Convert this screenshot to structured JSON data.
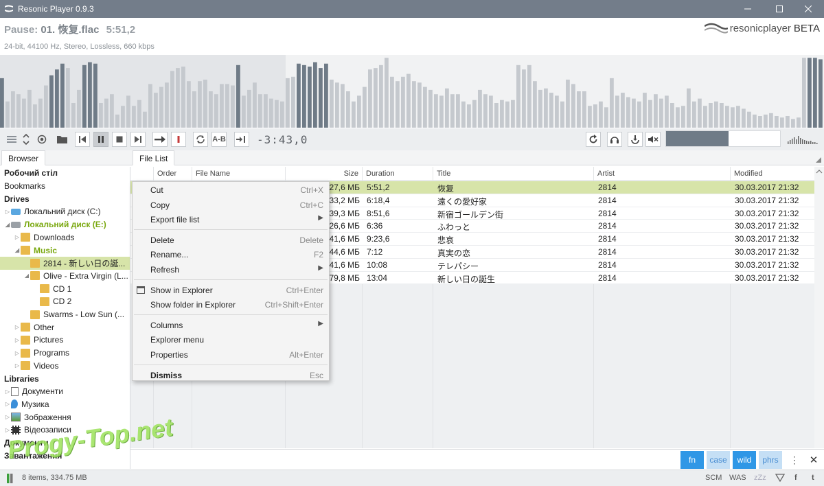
{
  "window": {
    "title": "Resonic Player 0.9.3"
  },
  "now_playing": {
    "state": "Pause:",
    "track": "01.  恢复.flac",
    "time": "5:51,2",
    "info": "24-bit, 44100 Hz, Stereo, Lossless, 660 kbps"
  },
  "brand": {
    "name": "resonicplayer",
    "beta": "BETA"
  },
  "playback": {
    "remaining": "-3:43,0",
    "progress_fraction": 0.347,
    "volume_fraction": 0.55
  },
  "visualizer": {
    "levels": [
      0.68,
      0.36,
      0.5,
      0.46,
      0.4,
      0.52,
      0.32,
      0.4,
      0.58,
      0.72,
      0.8,
      0.88,
      0.82,
      0.34,
      0.52,
      0.86,
      0.9,
      0.88,
      0.34,
      0.4,
      0.46,
      0.18,
      0.3,
      0.44,
      0.3,
      0.38,
      0.22,
      0.6,
      0.48,
      0.56,
      0.62,
      0.78,
      0.82,
      0.84,
      0.64,
      0.5,
      0.64,
      0.66,
      0.5,
      0.46,
      0.6,
      0.6,
      0.58,
      0.86,
      0.44,
      0.52,
      0.62,
      0.46,
      0.46,
      0.4,
      0.38,
      0.36,
      0.68,
      0.7,
      0.88,
      0.86,
      0.84,
      0.9,
      0.82,
      0.88,
      0.66,
      0.62,
      0.6,
      0.5,
      0.36,
      0.44,
      0.56,
      0.8,
      0.82,
      0.86,
      0.96,
      0.7,
      0.64,
      0.7,
      0.74,
      0.64,
      0.62,
      0.56,
      0.52,
      0.46,
      0.44,
      0.54,
      0.46,
      0.46,
      0.36,
      0.32,
      0.38,
      0.52,
      0.46,
      0.44,
      0.34,
      0.38,
      0.36,
      0.38,
      0.86,
      0.8,
      0.86,
      0.64,
      0.52,
      0.54,
      0.48,
      0.44,
      0.36,
      0.66,
      0.6,
      0.5,
      0.5,
      0.3,
      0.32,
      0.36,
      0.28,
      0.68,
      0.44,
      0.48,
      0.42,
      0.4,
      0.36,
      0.48,
      0.38,
      0.46,
      0.4,
      0.44,
      0.34,
      0.28,
      0.3,
      0.54,
      0.36,
      0.4,
      0.3,
      0.34,
      0.36,
      0.34,
      0.3,
      0.28,
      0.3,
      0.26,
      0.22,
      0.18,
      0.16,
      0.18,
      0.2,
      0.16,
      0.14,
      0.16,
      0.12,
      0.14,
      0.96,
      0.96,
      0.96,
      0.94
    ],
    "highlights": [
      0,
      9,
      10,
      11,
      15,
      16,
      17,
      43,
      54,
      55,
      56,
      57,
      58,
      59,
      147,
      148,
      149,
      150
    ]
  },
  "left_panel": {
    "tab": "Browser",
    "rows": [
      {
        "label": "Робочий стіл",
        "type": "section"
      },
      {
        "label": "Bookmarks",
        "type": "plain"
      },
      {
        "label": "Drives",
        "type": "section"
      },
      {
        "label": "Локальний диск (C:)",
        "type": "drive",
        "arrow": "▷",
        "indent": 0
      },
      {
        "label": "Локальний диск (E:)",
        "type": "drive-green",
        "arrow": "◢",
        "indent": 0
      },
      {
        "label": "Downloads",
        "type": "folder",
        "arrow": "▷",
        "indent": 1
      },
      {
        "label": "Music",
        "type": "folder-green",
        "arrow": "◢",
        "indent": 1
      },
      {
        "label": "2814 - 新しい日の誕...",
        "type": "folder-selected",
        "arrow": "",
        "indent": 2
      },
      {
        "label": "Olive - Extra Virgin (L...",
        "type": "folder",
        "arrow": "◢",
        "indent": 2
      },
      {
        "label": "CD 1",
        "type": "folder",
        "arrow": "",
        "indent": 3
      },
      {
        "label": "CD 2",
        "type": "folder",
        "arrow": "",
        "indent": 3
      },
      {
        "label": "Swarms - Low Sun (...",
        "type": "folder",
        "arrow": "",
        "indent": 2
      },
      {
        "label": "Other",
        "type": "folder",
        "arrow": "▷",
        "indent": 1
      },
      {
        "label": "Pictures",
        "type": "folder",
        "arrow": "▷",
        "indent": 1
      },
      {
        "label": "Programs",
        "type": "folder",
        "arrow": "▷",
        "indent": 1
      },
      {
        "label": "Videos",
        "type": "folder",
        "arrow": "▷",
        "indent": 1
      },
      {
        "label": "Libraries",
        "type": "section"
      },
      {
        "label": "Документи",
        "type": "lib-doc",
        "arrow": "▷",
        "indent": 0
      },
      {
        "label": "Музика",
        "type": "lib-music",
        "arrow": "▷",
        "indent": 0
      },
      {
        "label": "Зображення",
        "type": "lib-pic",
        "arrow": "▷",
        "indent": 0
      },
      {
        "label": "Відеозаписи",
        "type": "lib-video",
        "arrow": "▷",
        "indent": 0
      },
      {
        "label": "Документи",
        "type": "section"
      },
      {
        "label": "Завантаження",
        "type": "section"
      }
    ]
  },
  "file_list": {
    "tab": "File List",
    "columns": [
      "Order",
      "File Name",
      "Size",
      "Duration",
      "Title",
      "Artist",
      "Modified"
    ],
    "rows": [
      {
        "size": "27,6 МБ",
        "duration": "5:51,2",
        "title": "恢复",
        "artist": "2814",
        "modified": "30.03.2017 21:32",
        "playing": true
      },
      {
        "size": "33,2 МБ",
        "duration": "6:18,4",
        "title": "遠くの愛好家",
        "artist": "2814",
        "modified": "30.03.2017 21:32"
      },
      {
        "size": "39,3 МБ",
        "duration": "8:51,6",
        "title": "新宿ゴールデン街",
        "artist": "2814",
        "modified": "30.03.2017 21:32"
      },
      {
        "size": "26,6 МБ",
        "duration": "6:36",
        "title": "ふわっと",
        "artist": "2814",
        "modified": "30.03.2017 21:32"
      },
      {
        "size": "41,6 МБ",
        "duration": "9:23,6",
        "title": "悲哀",
        "artist": "2814",
        "modified": "30.03.2017 21:32"
      },
      {
        "size": "44,6 МБ",
        "duration": "7:12",
        "title": "真実の恋",
        "artist": "2814",
        "modified": "30.03.2017 21:32"
      },
      {
        "size": "41,6 МБ",
        "duration": "10:08",
        "title": "テレパシー",
        "artist": "2814",
        "modified": "30.03.2017 21:32"
      },
      {
        "size": "79,8 МБ",
        "duration": "13:04",
        "title": "新しい日の誕生",
        "artist": "2814",
        "modified": "30.03.2017 21:32"
      }
    ]
  },
  "context_menu": {
    "items": [
      {
        "label": "Cut",
        "shortcut": "Ctrl+X"
      },
      {
        "label": "Copy",
        "shortcut": "Ctrl+C"
      },
      {
        "label": "Export file list",
        "submenu": "▶"
      },
      {
        "separator": true
      },
      {
        "label": "Delete",
        "shortcut": "Delete"
      },
      {
        "label": "Rename...",
        "shortcut": "F2"
      },
      {
        "label": "Refresh",
        "submenu": "▶"
      },
      {
        "separator": true
      },
      {
        "label": "Show in Explorer",
        "shortcut": "Ctrl+Enter",
        "icon": true
      },
      {
        "label": "Show folder in Explorer",
        "shortcut": "Ctrl+Shift+Enter"
      },
      {
        "separator": true
      },
      {
        "label": "Columns",
        "submenu": "▶"
      },
      {
        "label": "Explorer menu"
      },
      {
        "label": "Properties",
        "shortcut": "Alt+Enter"
      },
      {
        "separator": true
      },
      {
        "label": "Dismiss",
        "shortcut": "Esc",
        "bold": true
      }
    ]
  },
  "filter_bar": {
    "fn": "fn",
    "case": "case",
    "wild": "wild",
    "phrs": "phrs",
    "more": "⋮",
    "close": "✕"
  },
  "status_bar": {
    "text": "8 items, 334.75 MB",
    "scm": "SCM",
    "was": "WAS",
    "zzz": "zZz",
    "facebook": "f",
    "twitter": "t"
  },
  "watermark": "Progy-Top.net",
  "colors": {
    "titlebar": "#737d8a",
    "selection": "#d7e4a9",
    "accent_blue": "#2f97e6",
    "bar": "#6f7b87",
    "bar_light": "#c5c9ce"
  }
}
